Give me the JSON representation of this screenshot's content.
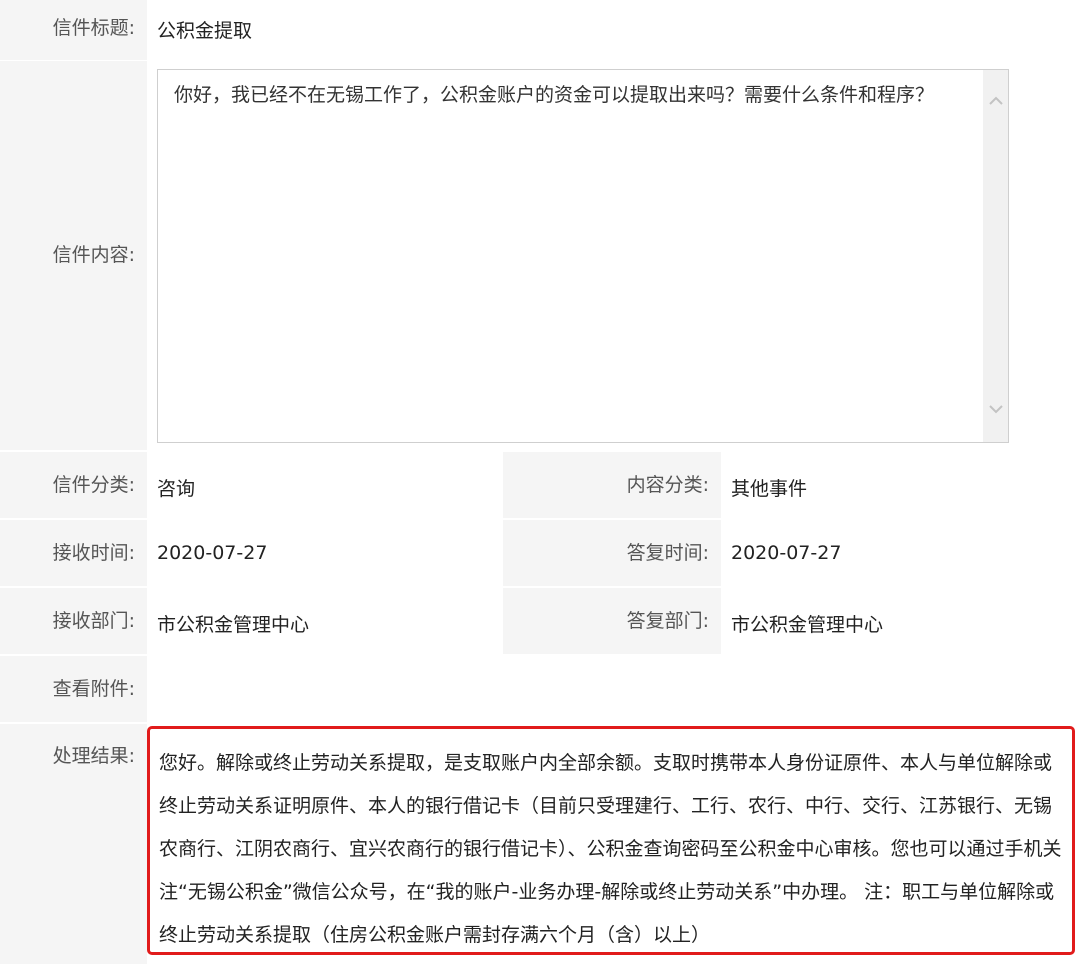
{
  "subject": {
    "label": "信件标题:",
    "value": "公积金提取"
  },
  "content": {
    "label": "信件内容:",
    "text": "你好，我已经不在无锡工作了，公积金账户的资金可以提取出来吗？需要什么条件和程序？"
  },
  "category": {
    "label": "信件分类:",
    "value": "咨询"
  },
  "content_category": {
    "label": "内容分类:",
    "value": "其他事件"
  },
  "receive_time": {
    "label": "接收时间:",
    "value": "2020-07-27"
  },
  "reply_time": {
    "label": "答复时间:",
    "value": "2020-07-27"
  },
  "receive_dept": {
    "label": "接收部门:",
    "value": "市公积金管理中心"
  },
  "reply_dept": {
    "label": "答复部门:",
    "value": "市公积金管理中心"
  },
  "attachments": {
    "label": "查看附件:"
  },
  "result": {
    "label": "处理结果:",
    "text": "您好。解除或终止劳动关系提取，是支取账户内全部余额。支取时携带本人身份证原件、本人与单位解除或终止劳动关系证明原件、本人的银行借记卡（目前只受理建行、工行、农行、中行、交行、江苏银行、无锡农商行、江阴农商行、宜兴农商行的银行借记卡）、公积金查询密码至公积金中心审核。您也可以通过手机关注“无锡公积金”微信公众号，在“我的账户-业务办理-解除或终止劳动关系”中办理。 注：职工与单位解除或终止劳动关系提取（住房公积金账户需封存满六个月（含）以上）",
    "highlight_color": "#e11b1b"
  },
  "icons": {
    "scroll_up": "chevron-up-icon",
    "scroll_down": "chevron-down-icon"
  }
}
